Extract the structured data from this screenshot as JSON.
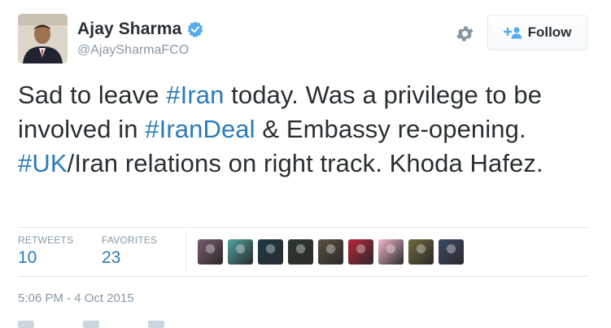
{
  "user": {
    "name": "Ajay Sharma",
    "handle": "@AjaySharmaFCO",
    "verified": true
  },
  "actions": {
    "follow_label": "Follow"
  },
  "tweet": {
    "segments": [
      {
        "text": "Sad to leave ",
        "type": "text"
      },
      {
        "text": "#Iran",
        "type": "hashtag"
      },
      {
        "text": " today. Was a privilege to be involved in  ",
        "type": "text"
      },
      {
        "text": "#IranDeal",
        "type": "hashtag"
      },
      {
        "text": " & Embassy re-opening. ",
        "type": "text"
      },
      {
        "text": "#UK",
        "type": "hashtag"
      },
      {
        "text": "/Iran relations on right track. Khoda Hafez.",
        "type": "text"
      }
    ]
  },
  "stats": {
    "retweets_label": "RETWEETS",
    "retweets_value": "10",
    "favorites_label": "FAVORITES",
    "favorites_value": "23"
  },
  "favoriters": [
    {
      "color": "#7a5a6e"
    },
    {
      "color": "#4fa3a0"
    },
    {
      "color": "#1c3b47"
    },
    {
      "color": "#2e3a2c"
    },
    {
      "color": "#5a5040"
    },
    {
      "color": "#b8243a"
    },
    {
      "color": "#f3b7c9"
    },
    {
      "color": "#6e6a3a"
    },
    {
      "color": "#3c4a66"
    }
  ],
  "timestamp": "5:06 PM - 4 Oct 2015",
  "colors": {
    "link": "#2b7bb9",
    "verified": "#55acee",
    "muted": "#8899a6"
  }
}
